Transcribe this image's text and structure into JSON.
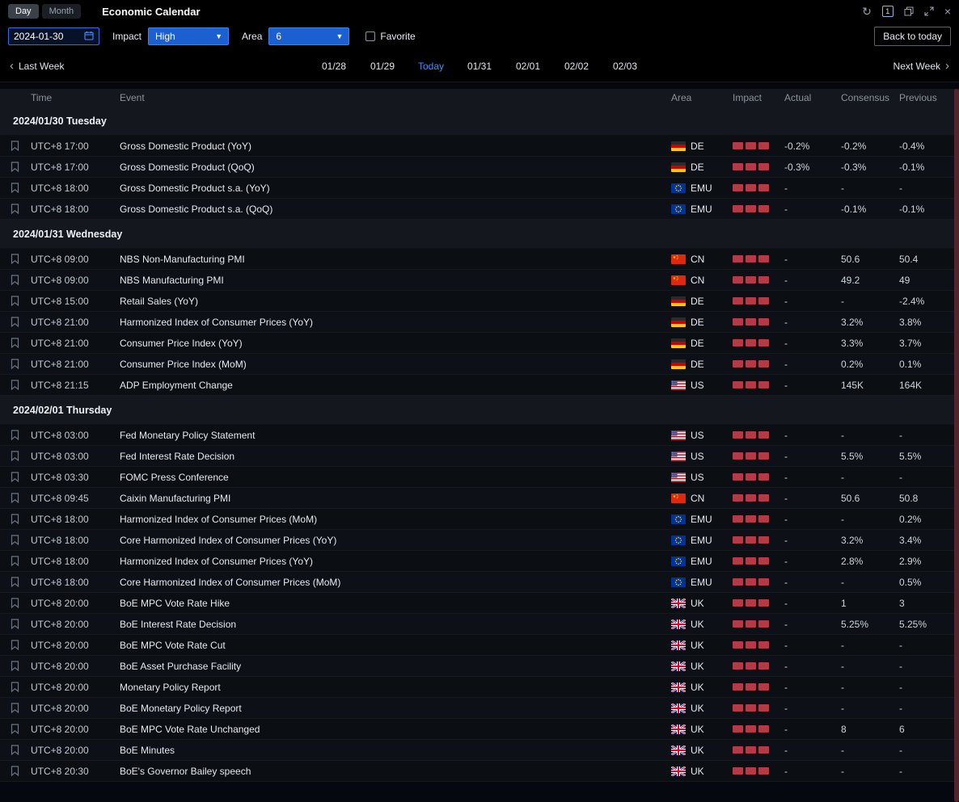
{
  "titlebar": {
    "mode_tabs": [
      {
        "label": "Day",
        "active": true
      },
      {
        "label": "Month",
        "active": false
      }
    ],
    "title": "Economic Calendar",
    "layout_badge": "1"
  },
  "filters": {
    "date_value": "2024-01-30",
    "impact_label": "Impact",
    "impact_value": "High",
    "area_label": "Area",
    "area_value": "6",
    "favorite_label": "Favorite",
    "favorite_checked": false,
    "back_to_today_label": "Back to today"
  },
  "week_nav": {
    "last_week_label": "Last Week",
    "next_week_label": "Next Week",
    "days": [
      "01/28",
      "01/29",
      "Today",
      "01/31",
      "02/01",
      "02/02",
      "02/03"
    ],
    "active_day": "Today"
  },
  "table": {
    "columns": [
      "Time",
      "Event",
      "Area",
      "Impact",
      "Actual",
      "Consensus",
      "Previous"
    ],
    "sections": [
      {
        "date_header": "2024/01/30 Tuesday",
        "rows": [
          {
            "time": "UTC+8 17:00",
            "event": "Gross Domestic Product (YoY)",
            "area": "DE",
            "impact": 3,
            "actual": "-0.2%",
            "consensus": "-0.2%",
            "previous": "-0.4%"
          },
          {
            "time": "UTC+8 17:00",
            "event": "Gross Domestic Product (QoQ)",
            "area": "DE",
            "impact": 3,
            "actual": "-0.3%",
            "consensus": "-0.3%",
            "previous": "-0.1%"
          },
          {
            "time": "UTC+8 18:00",
            "event": "Gross Domestic Product s.a. (YoY)",
            "area": "EMU",
            "impact": 3,
            "actual": "-",
            "consensus": "-",
            "previous": "-"
          },
          {
            "time": "UTC+8 18:00",
            "event": "Gross Domestic Product s.a. (QoQ)",
            "area": "EMU",
            "impact": 3,
            "actual": "-",
            "consensus": "-0.1%",
            "previous": "-0.1%"
          }
        ]
      },
      {
        "date_header": "2024/01/31 Wednesday",
        "rows": [
          {
            "time": "UTC+8 09:00",
            "event": "NBS Non-Manufacturing PMI",
            "area": "CN",
            "impact": 3,
            "actual": "-",
            "consensus": "50.6",
            "previous": "50.4"
          },
          {
            "time": "UTC+8 09:00",
            "event": "NBS Manufacturing PMI",
            "area": "CN",
            "impact": 3,
            "actual": "-",
            "consensus": "49.2",
            "previous": "49"
          },
          {
            "time": "UTC+8 15:00",
            "event": "Retail Sales (YoY)",
            "area": "DE",
            "impact": 3,
            "actual": "-",
            "consensus": "-",
            "previous": "-2.4%"
          },
          {
            "time": "UTC+8 21:00",
            "event": "Harmonized Index of Consumer Prices (YoY)",
            "area": "DE",
            "impact": 3,
            "actual": "-",
            "consensus": "3.2%",
            "previous": "3.8%"
          },
          {
            "time": "UTC+8 21:00",
            "event": "Consumer Price Index (YoY)",
            "area": "DE",
            "impact": 3,
            "actual": "-",
            "consensus": "3.3%",
            "previous": "3.7%"
          },
          {
            "time": "UTC+8 21:00",
            "event": "Consumer Price Index (MoM)",
            "area": "DE",
            "impact": 3,
            "actual": "-",
            "consensus": "0.2%",
            "previous": "0.1%"
          },
          {
            "time": "UTC+8 21:15",
            "event": "ADP Employment Change",
            "area": "US",
            "impact": 3,
            "actual": "-",
            "consensus": "145K",
            "previous": "164K"
          }
        ]
      },
      {
        "date_header": "2024/02/01 Thursday",
        "rows": [
          {
            "time": "UTC+8 03:00",
            "event": "Fed Monetary Policy Statement",
            "area": "US",
            "impact": 3,
            "actual": "-",
            "consensus": "-",
            "previous": "-"
          },
          {
            "time": "UTC+8 03:00",
            "event": "Fed Interest Rate Decision",
            "area": "US",
            "impact": 3,
            "actual": "-",
            "consensus": "5.5%",
            "previous": "5.5%"
          },
          {
            "time": "UTC+8 03:30",
            "event": "FOMC Press Conference",
            "area": "US",
            "impact": 3,
            "actual": "-",
            "consensus": "-",
            "previous": "-"
          },
          {
            "time": "UTC+8 09:45",
            "event": "Caixin Manufacturing PMI",
            "area": "CN",
            "impact": 3,
            "actual": "-",
            "consensus": "50.6",
            "previous": "50.8"
          },
          {
            "time": "UTC+8 18:00",
            "event": "Harmonized Index of Consumer Prices (MoM)",
            "area": "EMU",
            "impact": 3,
            "actual": "-",
            "consensus": "-",
            "previous": "0.2%"
          },
          {
            "time": "UTC+8 18:00",
            "event": "Core Harmonized Index of Consumer Prices (YoY)",
            "area": "EMU",
            "impact": 3,
            "actual": "-",
            "consensus": "3.2%",
            "previous": "3.4%"
          },
          {
            "time": "UTC+8 18:00",
            "event": "Harmonized Index of Consumer Prices (YoY)",
            "area": "EMU",
            "impact": 3,
            "actual": "-",
            "consensus": "2.8%",
            "previous": "2.9%"
          },
          {
            "time": "UTC+8 18:00",
            "event": "Core Harmonized Index of Consumer Prices (MoM)",
            "area": "EMU",
            "impact": 3,
            "actual": "-",
            "consensus": "-",
            "previous": "0.5%"
          },
          {
            "time": "UTC+8 20:00",
            "event": "BoE MPC Vote Rate Hike",
            "area": "UK",
            "impact": 3,
            "actual": "-",
            "consensus": "1",
            "previous": "3"
          },
          {
            "time": "UTC+8 20:00",
            "event": "BoE Interest Rate Decision",
            "area": "UK",
            "impact": 3,
            "actual": "-",
            "consensus": "5.25%",
            "previous": "5.25%"
          },
          {
            "time": "UTC+8 20:00",
            "event": "BoE MPC Vote Rate Cut",
            "area": "UK",
            "impact": 3,
            "actual": "-",
            "consensus": "-",
            "previous": "-"
          },
          {
            "time": "UTC+8 20:00",
            "event": "BoE Asset Purchase Facility",
            "area": "UK",
            "impact": 3,
            "actual": "-",
            "consensus": "-",
            "previous": "-"
          },
          {
            "time": "UTC+8 20:00",
            "event": "Monetary Policy Report",
            "area": "UK",
            "impact": 3,
            "actual": "-",
            "consensus": "-",
            "previous": "-"
          },
          {
            "time": "UTC+8 20:00",
            "event": "BoE Monetary Policy Report",
            "area": "UK",
            "impact": 3,
            "actual": "-",
            "consensus": "-",
            "previous": "-"
          },
          {
            "time": "UTC+8 20:00",
            "event": "BoE MPC Vote Rate Unchanged",
            "area": "UK",
            "impact": 3,
            "actual": "-",
            "consensus": "8",
            "previous": "6"
          },
          {
            "time": "UTC+8 20:00",
            "event": "BoE Minutes",
            "area": "UK",
            "impact": 3,
            "actual": "-",
            "consensus": "-",
            "previous": "-"
          },
          {
            "time": "UTC+8 20:30",
            "event": "BoE's Governor Bailey speech",
            "area": "UK",
            "impact": 3,
            "actual": "-",
            "consensus": "-",
            "previous": "-"
          }
        ]
      }
    ]
  },
  "colors": {
    "accent_blue": "#1b5fd0",
    "today_blue": "#3e8fff",
    "impact_red": "#b43a47",
    "scrollbar_red": "#52242b"
  }
}
